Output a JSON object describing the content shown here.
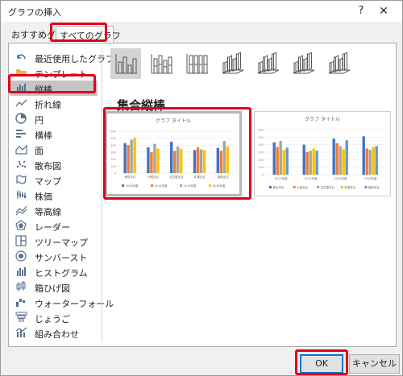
{
  "window": {
    "title": "グラフの挿入",
    "help_glyph": "?",
    "close_glyph": "✕"
  },
  "tabs": [
    {
      "label": "おすすめグラフ"
    },
    {
      "label": "すべてのグラフ"
    }
  ],
  "categories": [
    {
      "label": "最近使用したグラフ",
      "icon": "undo-icon"
    },
    {
      "label": "テンプレート",
      "icon": "folder-icon"
    },
    {
      "label": "縦棒",
      "icon": "column-chart-icon"
    },
    {
      "label": "折れ線",
      "icon": "line-chart-icon"
    },
    {
      "label": "円",
      "icon": "pie-chart-icon"
    },
    {
      "label": "横棒",
      "icon": "bar-chart-icon"
    },
    {
      "label": "面",
      "icon": "area-chart-icon"
    },
    {
      "label": "散布図",
      "icon": "scatter-chart-icon"
    },
    {
      "label": "マップ",
      "icon": "map-chart-icon"
    },
    {
      "label": "株価",
      "icon": "stock-chart-icon"
    },
    {
      "label": "等高線",
      "icon": "surface-chart-icon"
    },
    {
      "label": "レーダー",
      "icon": "radar-chart-icon"
    },
    {
      "label": "ツリーマップ",
      "icon": "treemap-chart-icon"
    },
    {
      "label": "サンバースト",
      "icon": "sunburst-chart-icon"
    },
    {
      "label": "ヒストグラム",
      "icon": "histogram-chart-icon"
    },
    {
      "label": "箱ひげ図",
      "icon": "box-whisker-chart-icon"
    },
    {
      "label": "ウォーターフォール",
      "icon": "waterfall-chart-icon"
    },
    {
      "label": "じょうご",
      "icon": "funnel-chart-icon"
    },
    {
      "label": "組み合わせ",
      "icon": "combo-chart-icon"
    }
  ],
  "selected_category": "縦棒",
  "subtypes": [
    {
      "name": "clustered-column"
    },
    {
      "name": "stacked-column"
    },
    {
      "name": "100-stacked-column"
    },
    {
      "name": "3d-clustered-column"
    },
    {
      "name": "3d-stacked-column"
    },
    {
      "name": "3d-100-stacked-column"
    },
    {
      "name": "3d-column"
    }
  ],
  "subtype_title": "集合縦棒",
  "previews": [
    {
      "title": "グラフ タイトル",
      "categories": [
        "東京本社",
        "大阪支社",
        "名古屋支社",
        "札幌支社",
        "福岡支社"
      ],
      "series": [
        "2013年度",
        "2014年度",
        "2015年度",
        "2016年度"
      ]
    },
    {
      "title": "グラフ タイトル",
      "categories": [
        "2013年度",
        "2014年度",
        "2015年度",
        "2016年度"
      ],
      "series": [
        "東京本社",
        "大阪支社",
        "名古屋支社",
        "札幌支社",
        "福岡支社"
      ]
    }
  ],
  "buttons": {
    "ok": "OK",
    "cancel": "キャンセル"
  },
  "colors": {
    "highlight": "#e0001b",
    "series": [
      "#4472c4",
      "#ed7d31",
      "#a5a5a5",
      "#ffc000",
      "#5b9bd5"
    ]
  }
}
